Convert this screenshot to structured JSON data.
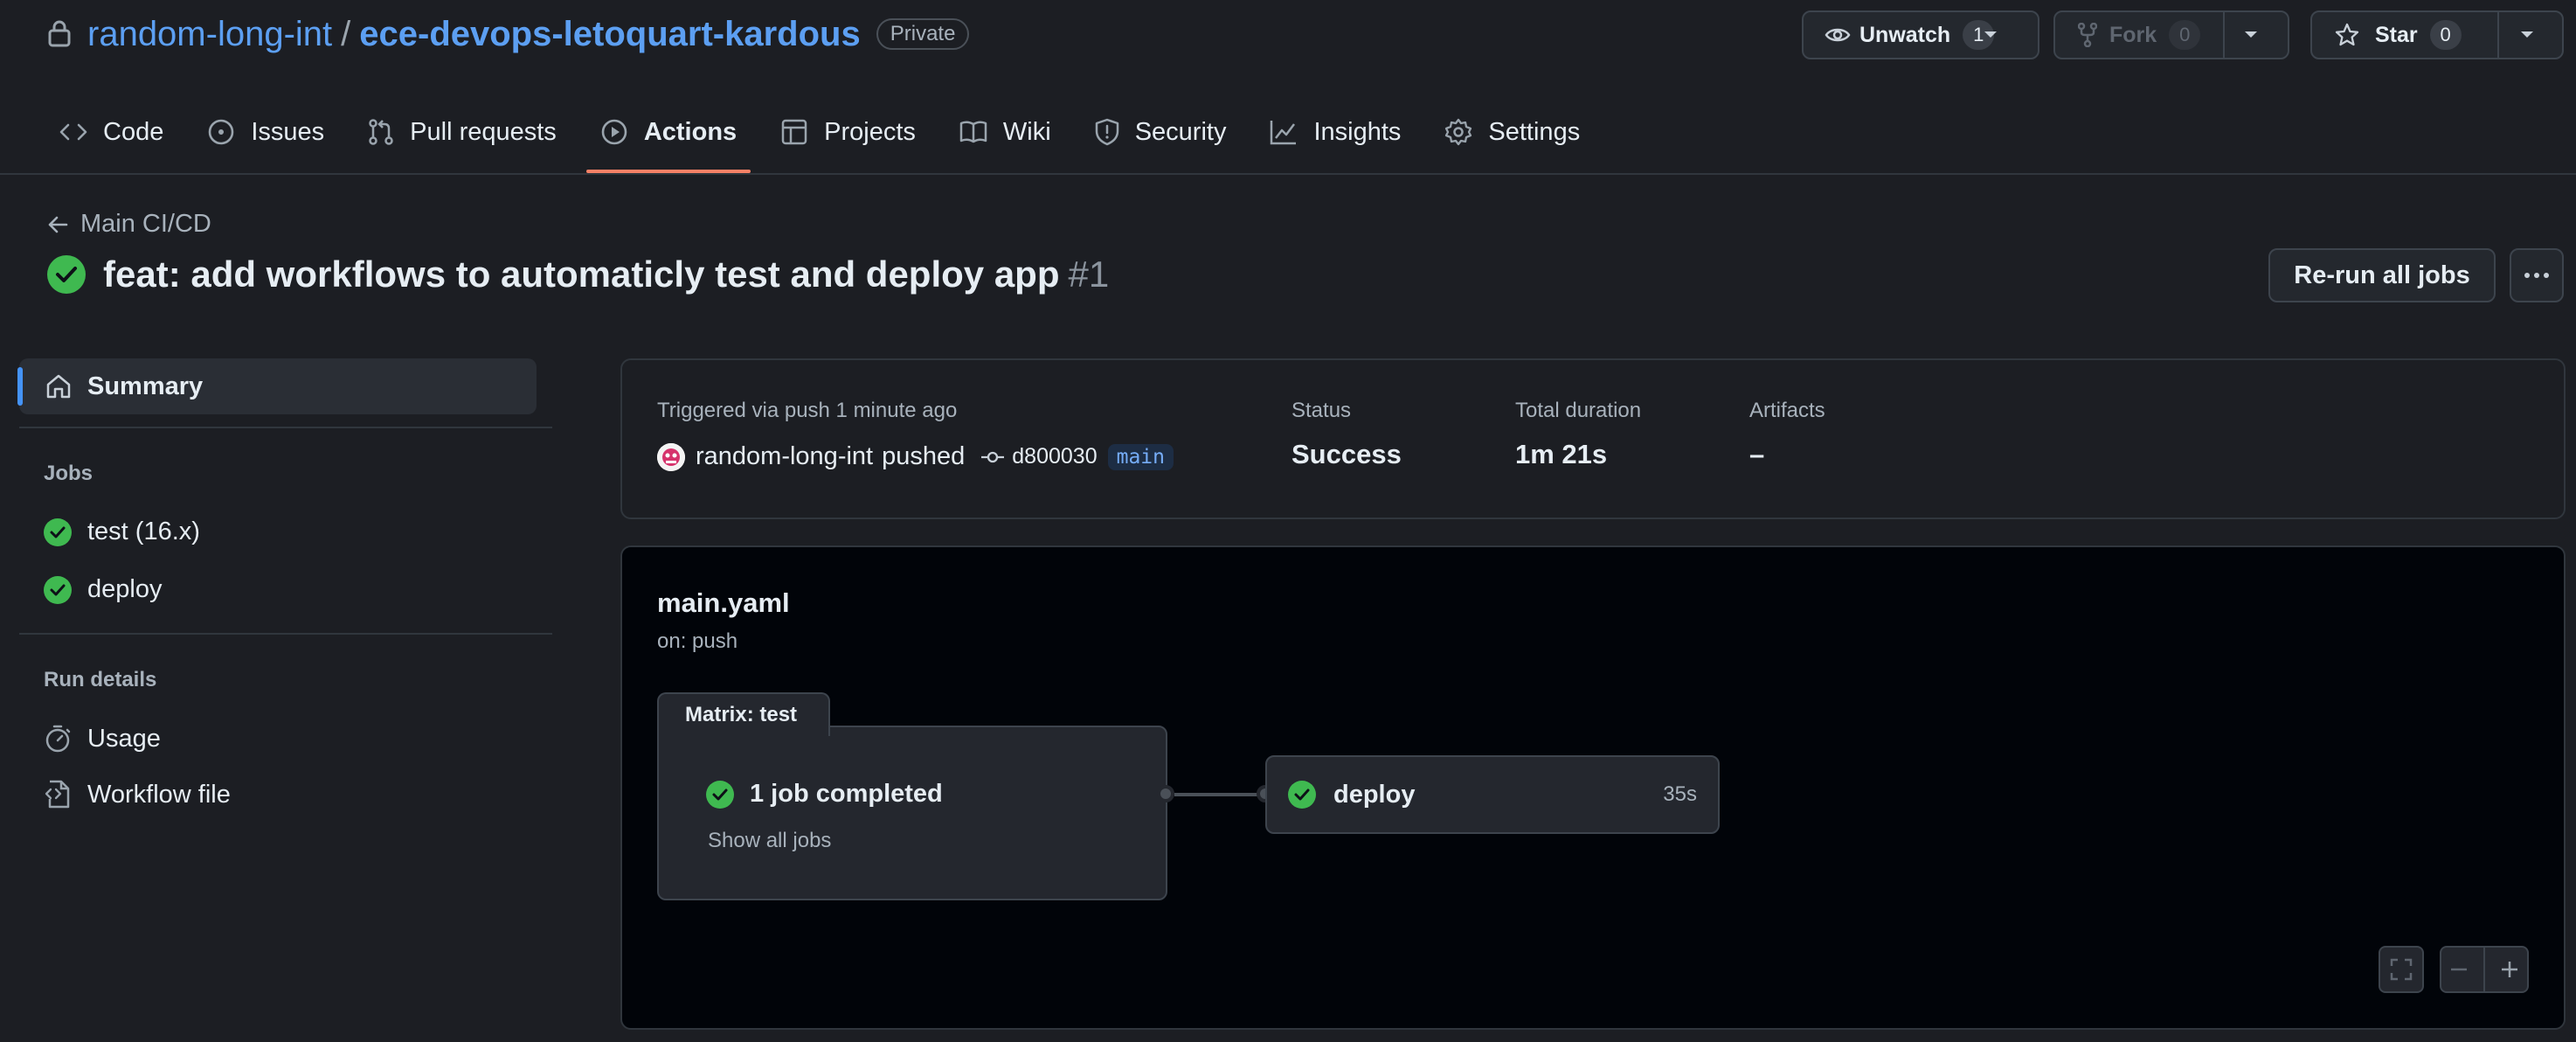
{
  "repo": {
    "owner": "random-long-int",
    "separator": "/",
    "name": "ece-devops-letoquart-kardous",
    "visibility": "Private"
  },
  "header_actions": {
    "watch": {
      "label": "Unwatch",
      "count": "1"
    },
    "fork": {
      "label": "Fork",
      "count": "0"
    },
    "star": {
      "label": "Star",
      "count": "0"
    }
  },
  "tabs": [
    {
      "label": "Code",
      "icon": "code-icon"
    },
    {
      "label": "Issues",
      "icon": "issue-icon"
    },
    {
      "label": "Pull requests",
      "icon": "pull-request-icon"
    },
    {
      "label": "Actions",
      "icon": "play-icon",
      "active": true
    },
    {
      "label": "Projects",
      "icon": "table-icon"
    },
    {
      "label": "Wiki",
      "icon": "book-icon"
    },
    {
      "label": "Security",
      "icon": "shield-icon"
    },
    {
      "label": "Insights",
      "icon": "graph-icon"
    },
    {
      "label": "Settings",
      "icon": "gear-icon"
    }
  ],
  "run": {
    "back_label": "Main CI/CD",
    "title": "feat: add workflows to automaticly test and deploy app",
    "number": "#1",
    "rerun_label": "Re-run all jobs"
  },
  "sidebar": {
    "summary_label": "Summary",
    "jobs_heading": "Jobs",
    "jobs": [
      {
        "label": "test (16.x)",
        "status": "success"
      },
      {
        "label": "deploy",
        "status": "success"
      }
    ],
    "run_details_heading": "Run details",
    "run_details": [
      {
        "label": "Usage",
        "icon": "stopwatch-icon"
      },
      {
        "label": "Workflow file",
        "icon": "file-code-icon"
      }
    ]
  },
  "summary": {
    "trigger_label": "Triggered via push 1 minute ago",
    "actor": "random-long-int",
    "action": "pushed",
    "commit": "d800030",
    "branch": "main",
    "status_label": "Status",
    "status_value": "Success",
    "duration_label": "Total duration",
    "duration_value": "1m 21s",
    "artifacts_label": "Artifacts",
    "artifacts_value": "–"
  },
  "workflow": {
    "file": "main.yaml",
    "trigger": "on: push",
    "matrix_label": "Matrix: test",
    "matrix_status": "1 job completed",
    "show_all_label": "Show all jobs",
    "job_name": "deploy",
    "job_duration": "35s"
  },
  "colors": {
    "background": "#1c1e23",
    "link": "#5c9ff2",
    "success": "#3fb950",
    "active_tab_underline": "#f78166"
  }
}
